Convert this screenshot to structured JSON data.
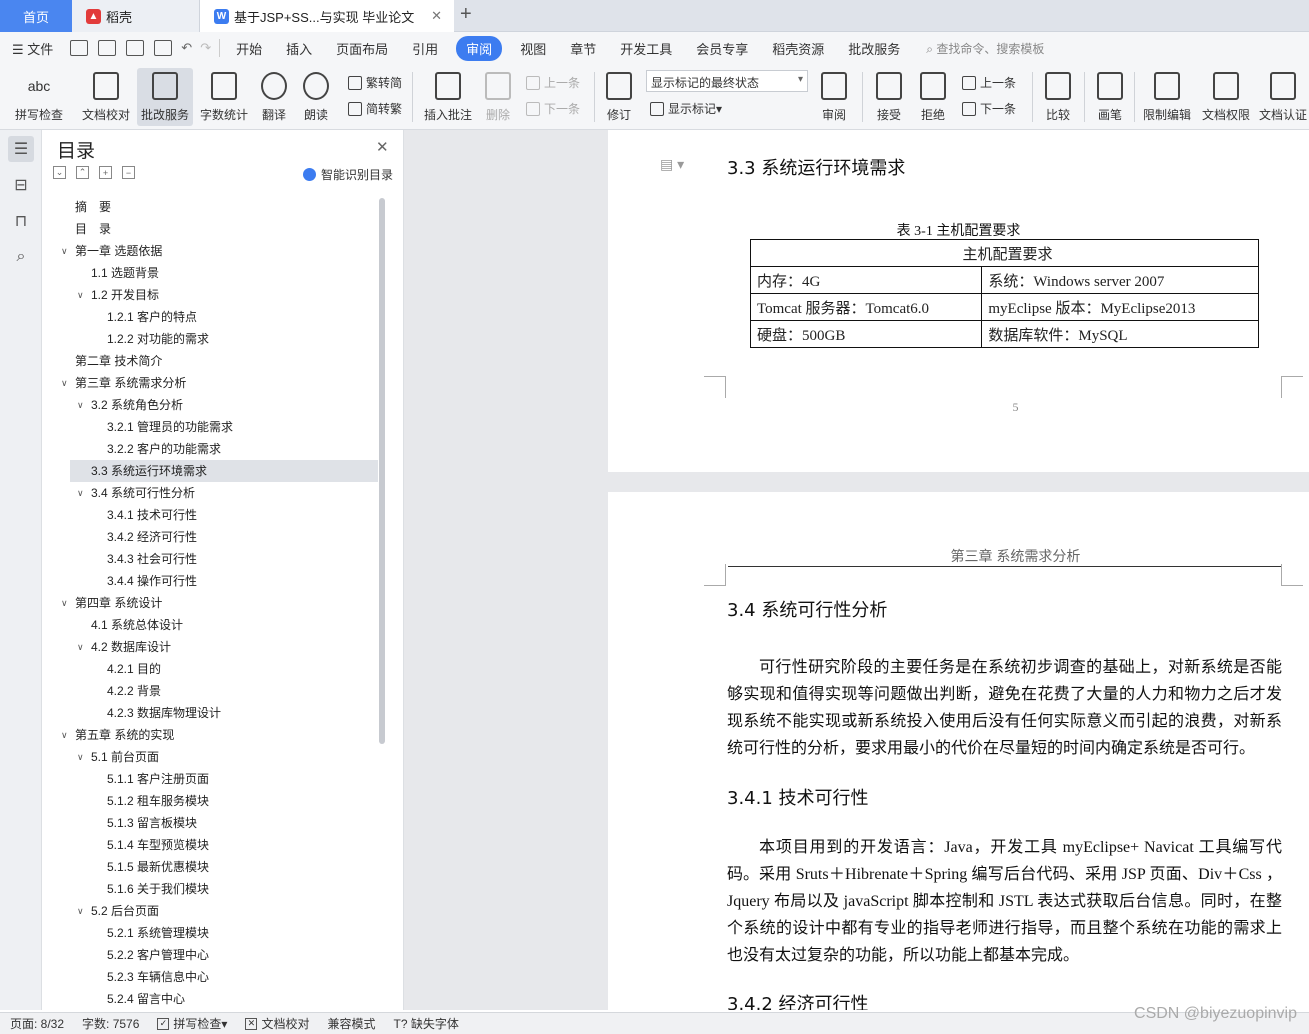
{
  "tabs": {
    "home": "首页",
    "doc1": "稻壳",
    "doc2": "基于JSP+SS...与实现 毕业论文"
  },
  "menu": {
    "file": "文件",
    "items": [
      "开始",
      "插入",
      "页面布局",
      "引用",
      "审阅",
      "视图",
      "章节",
      "开发工具",
      "会员专享",
      "稻壳资源",
      "批改服务"
    ],
    "active": "审阅",
    "search": "查找命令、搜索模板"
  },
  "ribbon": {
    "spell": "拼写检查",
    "proof": "文档校对",
    "correct": "批改服务",
    "count": "字数统计",
    "translate": "翻译",
    "read": "朗读",
    "trad": "繁转简",
    "simp": "简转繁",
    "insert_comment": "插入批注",
    "delete": "删除",
    "prev": "上一条",
    "next": "下一条",
    "revise": "修订",
    "markup_state": "显示标记的最终状态",
    "show_markup": "显示标记",
    "review": "审阅",
    "accept": "接受",
    "reject": "拒绝",
    "prev2": "上一条",
    "next2": "下一条",
    "compare": "比较",
    "pen": "画笔",
    "restrict": "限制编辑",
    "perm": "文档权限",
    "auth": "文档认证"
  },
  "nav": {
    "title": "目录",
    "smart": "智能识别目录",
    "items": [
      {
        "label": "摘　要",
        "level": 0,
        "arrow": ""
      },
      {
        "label": "目　录",
        "level": 0,
        "arrow": ""
      },
      {
        "label": "第一章  选题依据",
        "level": 0,
        "arrow": "v"
      },
      {
        "label": "1.1 选题背景",
        "level": 1,
        "arrow": ""
      },
      {
        "label": "1.2 开发目标",
        "level": 1,
        "arrow": "v"
      },
      {
        "label": "1.2.1 客户的特点",
        "level": 2,
        "arrow": ""
      },
      {
        "label": "1.2.2 对功能的需求",
        "level": 2,
        "arrow": ""
      },
      {
        "label": "第二章  技术简介",
        "level": 0,
        "arrow": ""
      },
      {
        "label": "第三章  系统需求分析",
        "level": 0,
        "arrow": "v"
      },
      {
        "label": "3.2  系统角色分析",
        "level": 1,
        "arrow": "v"
      },
      {
        "label": "3.2.1  管理员的功能需求",
        "level": 2,
        "arrow": ""
      },
      {
        "label": "3.2.2  客户的功能需求",
        "level": 2,
        "arrow": ""
      },
      {
        "label": "3.3  系统运行环境需求",
        "level": 1,
        "arrow": "",
        "selected": true
      },
      {
        "label": "3.4  系统可行性分析",
        "level": 1,
        "arrow": "v"
      },
      {
        "label": "3.4.1  技术可行性",
        "level": 2,
        "arrow": ""
      },
      {
        "label": "3.4.2  经济可行性",
        "level": 2,
        "arrow": ""
      },
      {
        "label": "3.4.3  社会可行性",
        "level": 2,
        "arrow": ""
      },
      {
        "label": "3.4.4  操作可行性",
        "level": 2,
        "arrow": ""
      },
      {
        "label": "第四章  系统设计",
        "level": 0,
        "arrow": "v"
      },
      {
        "label": "4.1  系统总体设计",
        "level": 1,
        "arrow": ""
      },
      {
        "label": "4.2  数据库设计",
        "level": 1,
        "arrow": "v"
      },
      {
        "label": "4.2.1  目的",
        "level": 2,
        "arrow": ""
      },
      {
        "label": "4.2.2  背景",
        "level": 2,
        "arrow": ""
      },
      {
        "label": "4.2.3  数据库物理设计",
        "level": 2,
        "arrow": ""
      },
      {
        "label": "第五章  系统的实现",
        "level": 0,
        "arrow": "v"
      },
      {
        "label": "5.1 前台页面",
        "level": 1,
        "arrow": "v"
      },
      {
        "label": "5.1.1 客户注册页面",
        "level": 2,
        "arrow": ""
      },
      {
        "label": "5.1.2 租车服务模块",
        "level": 2,
        "arrow": ""
      },
      {
        "label": "5.1.3 留言板模块",
        "level": 2,
        "arrow": ""
      },
      {
        "label": "5.1.4 车型预览模块",
        "level": 2,
        "arrow": ""
      },
      {
        "label": "5.1.5 最新优惠模块",
        "level": 2,
        "arrow": ""
      },
      {
        "label": "5.1.6 关于我们模块",
        "level": 2,
        "arrow": ""
      },
      {
        "label": "5.2  后台页面",
        "level": 1,
        "arrow": "v"
      },
      {
        "label": "5.2.1 系统管理模块",
        "level": 2,
        "arrow": ""
      },
      {
        "label": "5.2.2 客户管理中心",
        "level": 2,
        "arrow": ""
      },
      {
        "label": "5.2.3 车辆信息中心",
        "level": 2,
        "arrow": ""
      },
      {
        "label": "5.2.4 留言中心",
        "level": 2,
        "arrow": ""
      }
    ]
  },
  "doc": {
    "h33": "3.3 系统运行环境需求",
    "table_caption": "表 3-1  主机配置要求",
    "table_header": "主机配置要求",
    "rows": [
      [
        "内存：4G",
        "系统：Windows server 2007"
      ],
      [
        "Tomcat 服务器：Tomcat6.0",
        "myEclipse 版本：MyEclipse2013"
      ],
      [
        "硬盘：500GB",
        "数据库软件：MySQL"
      ]
    ],
    "page_number": "5",
    "running_head": "第三章  系统需求分析",
    "h34": "3.4 系统可行性分析",
    "p34": "可行性研究阶段的主要任务是在系统初步调查的基础上，对新系统是否能够实现和值得实现等问题做出判断，避免在花费了大量的人力和物力之后才发现系统不能实现或新系统投入使用后没有任何实际意义而引起的浪费，对新系统可行性的分析，要求用最小的代价在尽量短的时间内确定系统是否可行。",
    "h341": "3.4.1 技术可行性",
    "p341a": "本项目用到的开发语言：Java，开发工具 myEclipse+ Navicat 工具编写代码。",
    "p341b": "采用 Sruts＋Hibrenate＋Spring 编写后台代码、采用 JSP 页面、Div＋Css ，Jquery 布局以及 javaScript 脚本控制和 JSTL 表达式获取后台信息。同时，在整个系统的设计中都有专业的指导老师进行指导，而且整个系统在功能的需求上也没有太过复杂的功能，所以功能上都基本完成。",
    "h342": "3.4.2 经济可行性"
  },
  "status": {
    "page": "页面: 8/32",
    "words": "字数: 7576",
    "spell": "拼写检查",
    "proof": "文档校对",
    "compat": "兼容模式",
    "font": "缺失字体"
  },
  "watermark": "CSDN @biyezuopinvip"
}
